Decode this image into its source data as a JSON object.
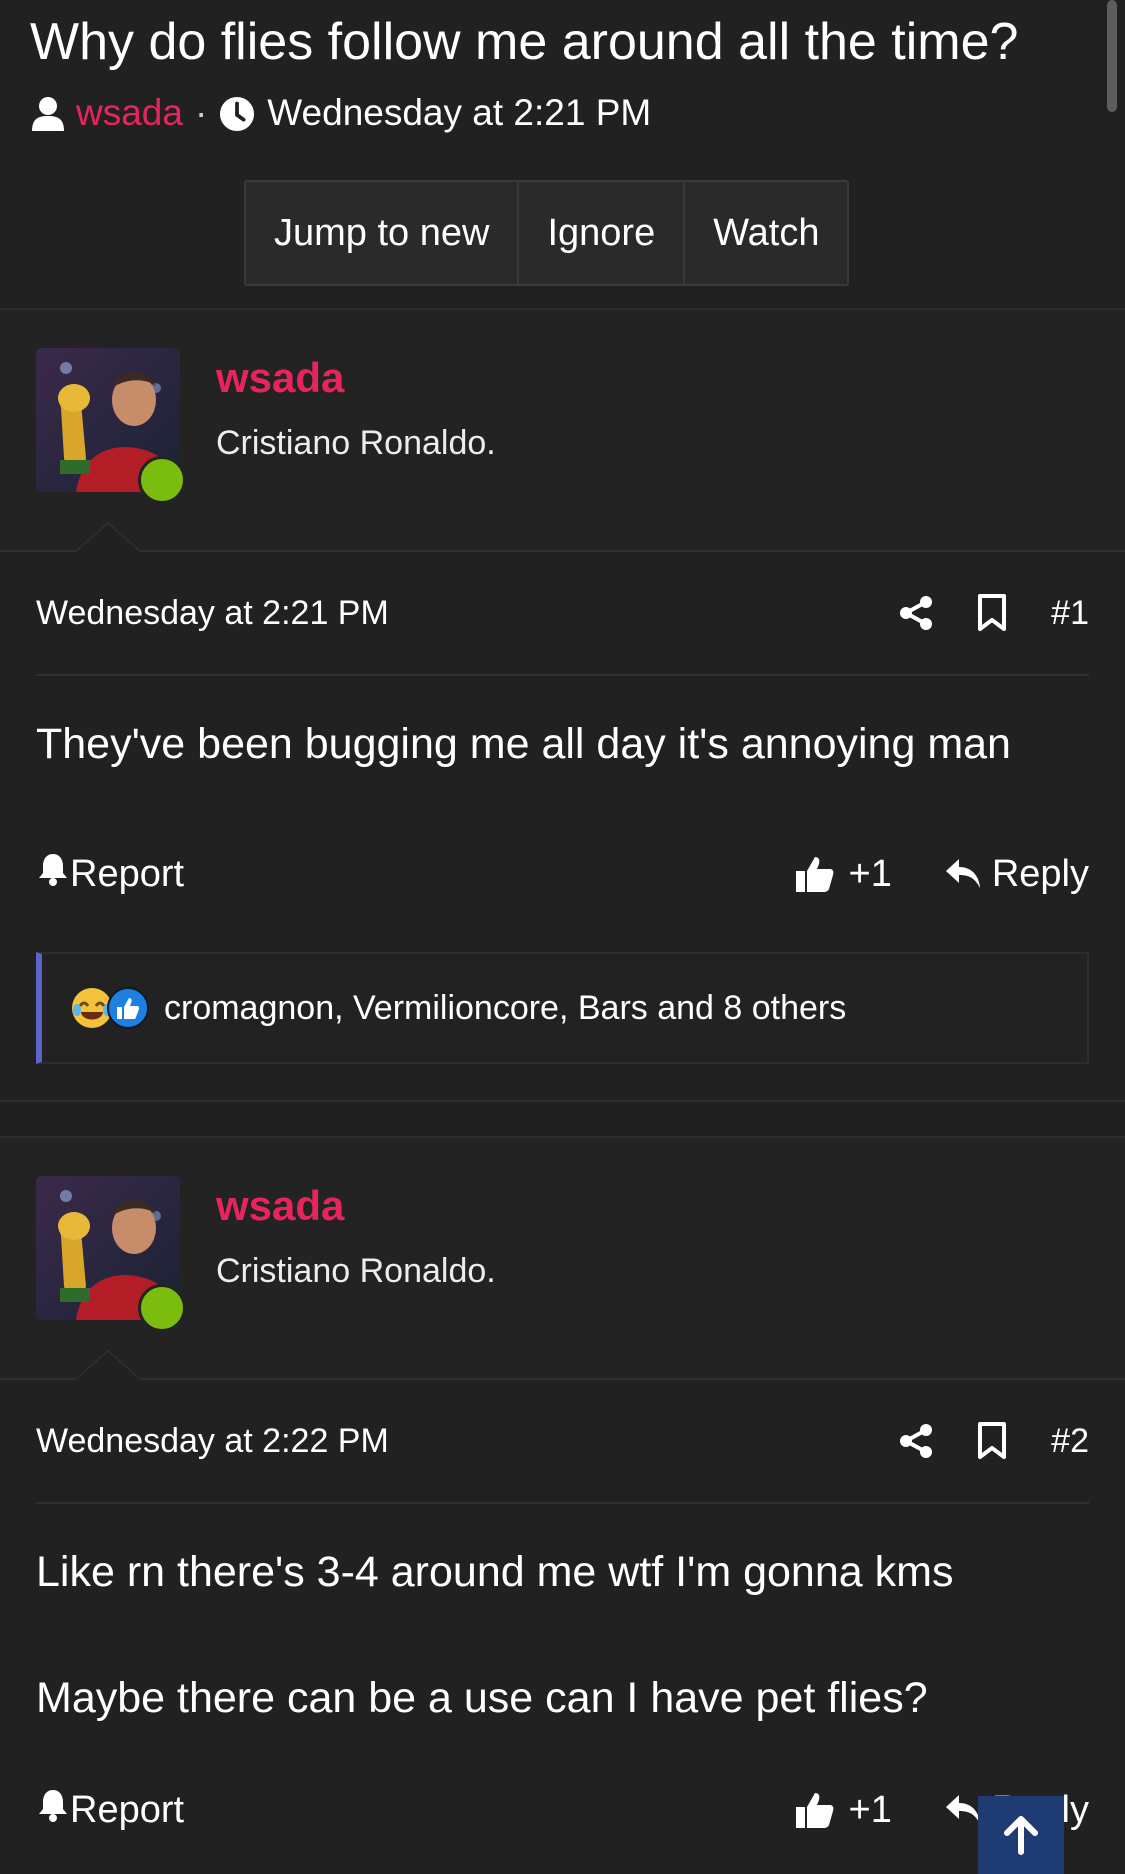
{
  "thread": {
    "title": "Why do flies follow me around all the time?",
    "author": "wsada",
    "dot": "·",
    "time": "Wednesday at 2:21 PM"
  },
  "buttons": {
    "jump": "Jump to new",
    "ignore": "Ignore",
    "watch": "Watch"
  },
  "posts": [
    {
      "username": "wsada",
      "user_title": "Cristiano Ronaldo.",
      "date": "Wednesday at 2:21 PM",
      "number": "#1",
      "lines": [
        "They've been bugging me all day it's annoying man"
      ],
      "report": "Report",
      "likes": "+1",
      "reply": "Reply",
      "reactions": "cromagnon, Vermilioncore, Bars and 8 others"
    },
    {
      "username": "wsada",
      "user_title": "Cristiano Ronaldo.",
      "date": "Wednesday at 2:22 PM",
      "number": "#2",
      "lines": [
        "Like rn there's 3-4 around me wtf I'm gonna kms",
        "Maybe there can be a use can I have pet flies?"
      ],
      "report": "Report",
      "likes": "+1",
      "reply": "Reply"
    }
  ],
  "colors": {
    "background": "#212122",
    "accent_username": "#e8245c",
    "online": "#7bbd0f",
    "reaction_bar": "#5d63c7",
    "scroll_top_button": "#1f3b73"
  },
  "icons": [
    "user-icon",
    "clock-icon",
    "share-icon",
    "bookmark-icon",
    "bell-icon",
    "thumbs-up-icon",
    "reply-icon",
    "arrow-up-icon",
    "laughing-emoji-icon",
    "like-reaction-icon"
  ]
}
